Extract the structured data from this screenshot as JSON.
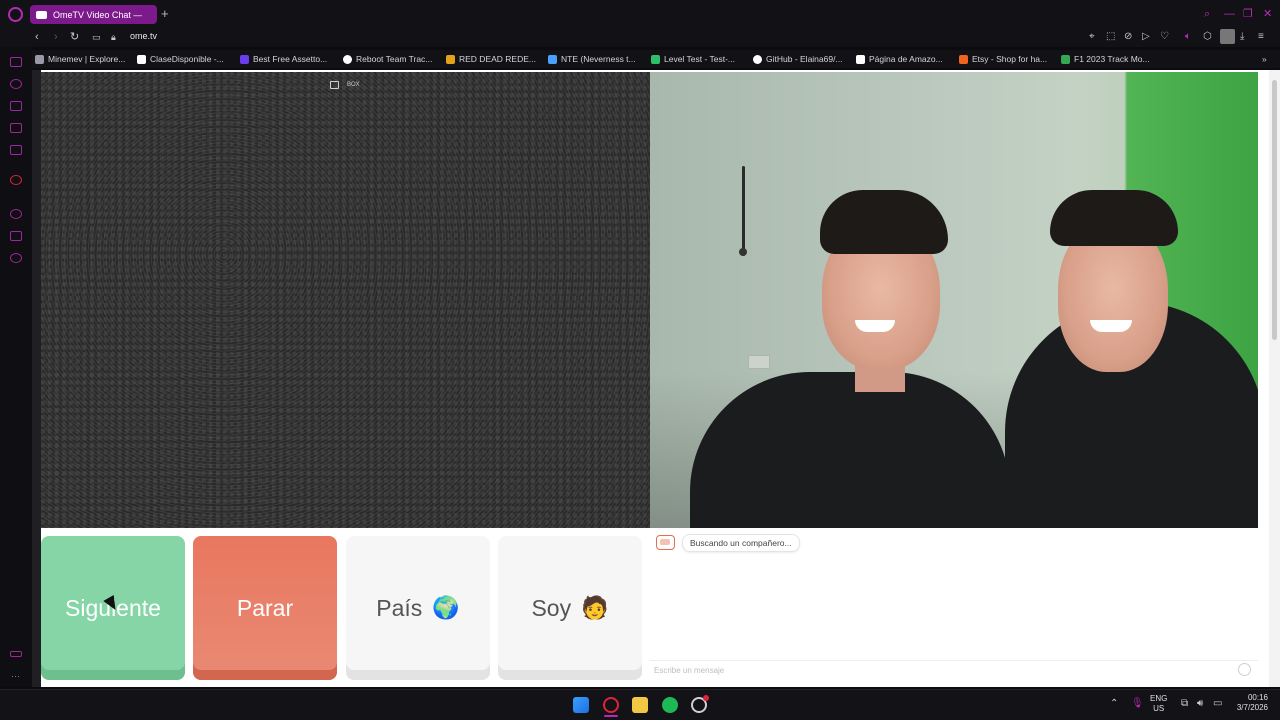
{
  "browser": {
    "tab_title": "OmeTV Video Chat — ",
    "new_tab": "+",
    "url": "ome.tv",
    "bookmarks": [
      {
        "label": "Minemev | Explore...",
        "color": "#9a9aa6"
      },
      {
        "label": "ClaseDisponible -...",
        "color": "#ffffff"
      },
      {
        "label": "Best Free Assetto...",
        "color": "#6a3df0"
      },
      {
        "label": "Reboot Team Trac...",
        "color": "#ffffff"
      },
      {
        "label": "RED DEAD REDE...",
        "color": "#e3a21a"
      },
      {
        "label": "NTE (Neverness t...",
        "color": "#4aa0ff"
      },
      {
        "label": "Level Test - Test-...",
        "color": "#2fbf6b"
      },
      {
        "label": "GitHub - Elaina69/...",
        "color": "#ffffff"
      },
      {
        "label": "Página de Amazo...",
        "color": "#ffffff"
      },
      {
        "label": "Etsy - Shop for ha...",
        "color": "#f1641e"
      },
      {
        "label": "F1 2023 Track Mo...",
        "color": "#34a853"
      }
    ]
  },
  "video": {
    "report_label": "BOX"
  },
  "controls": {
    "next_label": "Siguiente",
    "stop_label": "Parar",
    "country_label": "País",
    "country_emoji": "🌍",
    "gender_label": "Soy",
    "gender_emoji": "🧑"
  },
  "chat": {
    "status_message": "Buscando un compañero...",
    "input_placeholder": "Escribe un mensaje"
  },
  "taskbar": {
    "lang_line1": "ENG",
    "lang_line2": "US",
    "time": "00:16",
    "date": "3/7/2026"
  },
  "colors": {
    "next": "#85d5a6",
    "stop": "#e9775f",
    "opera_accent": "#b72ab8"
  }
}
